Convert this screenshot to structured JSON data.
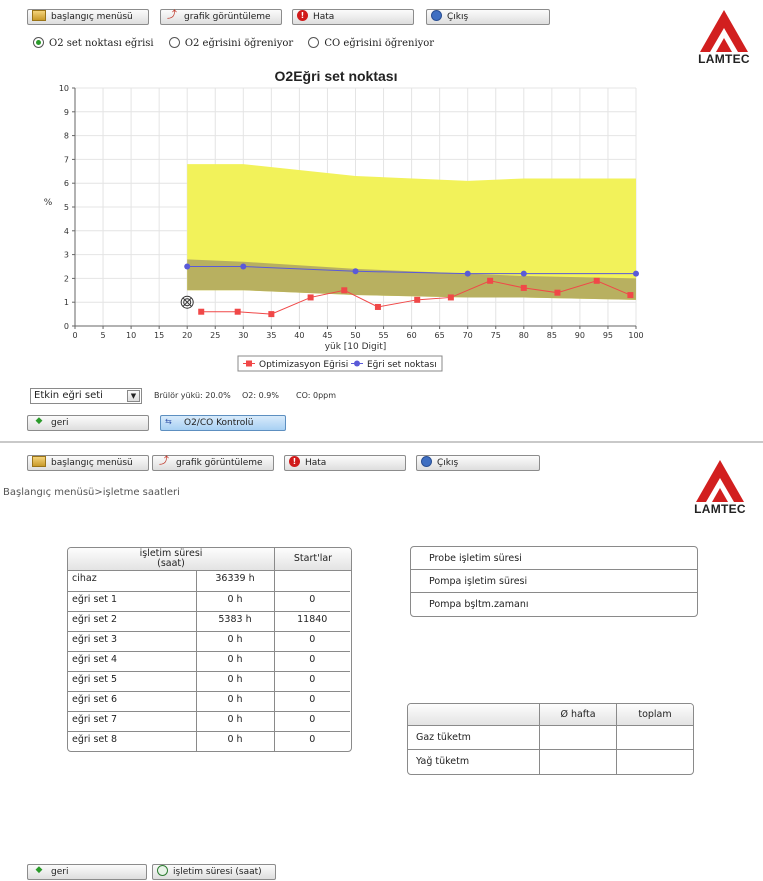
{
  "toolbar": {
    "home_label": "başlangıç menüsü",
    "graph_label": "grafik görüntüleme",
    "error_label": "Hata",
    "exit_label": "Çıkış"
  },
  "brand": {
    "logo_text": "LAMTEC",
    "logo_color": "#d21f1f"
  },
  "panel1": {
    "radios": [
      {
        "label": "O2 set noktası eğrisi",
        "selected": true
      },
      {
        "label": "O2 eğrisini öğreniyor",
        "selected": false
      },
      {
        "label": "CO eğrisini öğreniyor",
        "selected": false
      }
    ],
    "select_value": "Etkin eğri seti",
    "status_load": "Brülör yükü: 20.0%",
    "status_o2": "O2: 0.9%",
    "status_co": "CO: 0ppm",
    "back_label": "geri",
    "o2co_label": "O2/CO Kontrolü"
  },
  "chart_data": {
    "type": "line",
    "title": "O2Eğri set noktası",
    "xlabel": "yük [10 Digit]",
    "ylabel": "%",
    "xlim": [
      0,
      100
    ],
    "ylim": [
      0,
      10
    ],
    "xticks": [
      0,
      5,
      10,
      15,
      20,
      25,
      30,
      35,
      40,
      45,
      50,
      55,
      60,
      65,
      70,
      75,
      80,
      85,
      90,
      95,
      100
    ],
    "yticks": [
      0,
      1,
      2,
      3,
      4,
      5,
      6,
      7,
      8,
      9,
      10
    ],
    "grid": true,
    "legend_position": "bottom",
    "current_point": {
      "x": 20,
      "y": 1.0
    },
    "bands": [
      {
        "color": "#f2f25a",
        "x": [
          20,
          30,
          50,
          70,
          80,
          100
        ],
        "upper": [
          6.8,
          6.8,
          6.3,
          6.1,
          6.2,
          6.2
        ],
        "lower": [
          1.5,
          1.5,
          1.3,
          1.2,
          1.2,
          1.1
        ]
      },
      {
        "color": "#b8b060",
        "x": [
          20,
          30,
          50,
          70,
          80,
          100
        ],
        "upper": [
          2.8,
          2.7,
          2.4,
          2.2,
          2.1,
          2.0
        ],
        "lower": [
          1.5,
          1.5,
          1.3,
          1.2,
          1.2,
          1.1
        ]
      }
    ],
    "series": [
      {
        "name": "Optimizasyon Eğrisi",
        "color": "#f04848",
        "marker": "square",
        "x": [
          22.5,
          29,
          35,
          42,
          48,
          54,
          61,
          67,
          74,
          80,
          86,
          93,
          99
        ],
        "y": [
          0.6,
          0.6,
          0.5,
          1.2,
          1.5,
          0.8,
          1.1,
          1.2,
          1.9,
          1.6,
          1.4,
          1.9,
          1.3
        ]
      },
      {
        "name": "Eğri set noktası",
        "color": "#5a5ad8",
        "marker": "circle",
        "x": [
          20,
          30,
          50,
          70,
          80,
          100
        ],
        "y": [
          2.5,
          2.5,
          2.3,
          2.2,
          2.2,
          2.2
        ]
      }
    ]
  },
  "panel2": {
    "breadcrumb": "Başlangıç menüsü>işletme saatleri",
    "runtime_table": {
      "headers": [
        "işletim süresi\n(saat)",
        "Start'lar"
      ],
      "rows": [
        {
          "label": "cihaz",
          "hours": "36339 h",
          "starts": ""
        },
        {
          "label": "eğri set 1",
          "hours": "0 h",
          "starts": "0"
        },
        {
          "label": "eğri set 2",
          "hours": "5383 h",
          "starts": "11840"
        },
        {
          "label": "eğri set 3",
          "hours": "0 h",
          "starts": "0"
        },
        {
          "label": "eğri set 4",
          "hours": "0 h",
          "starts": "0"
        },
        {
          "label": "eğri set 5",
          "hours": "0 h",
          "starts": "0"
        },
        {
          "label": "eğri set 6",
          "hours": "0 h",
          "starts": "0"
        },
        {
          "label": "eğri set 7",
          "hours": "0 h",
          "starts": "0"
        },
        {
          "label": "eğri set 8",
          "hours": "0 h",
          "starts": "0"
        }
      ]
    },
    "probe_items": [
      "Probe işletim süresi",
      "Pompa işletim süresi",
      "Pompa bşltm.zamanı"
    ],
    "consumption_table": {
      "headers": [
        "",
        "Ø hafta",
        "toplam"
      ],
      "rows": [
        {
          "label": "Gaz tüketm",
          "week": "",
          "total": ""
        },
        {
          "label": "Yağ tüketm",
          "week": "",
          "total": ""
        }
      ]
    },
    "back_label": "geri",
    "runtime_label": "işletim süresi (saat)"
  }
}
